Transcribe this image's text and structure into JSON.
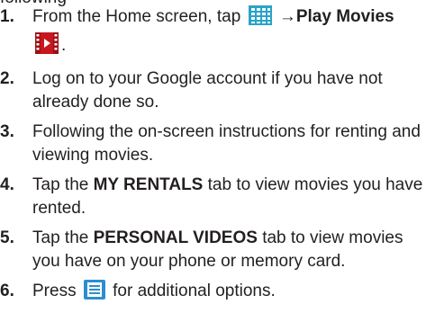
{
  "fragment_top": "following",
  "steps": [
    {
      "number": "1.",
      "before": "From the Home screen, tap",
      "apps_icon": "apps-grid-icon",
      "arrow": "→",
      "app_name": "Play Movies",
      "movies_icon": "play-movies-icon",
      "after": "."
    },
    {
      "number": "2.",
      "text": "Log on to your Google account if you have not already done so."
    },
    {
      "number": "3.",
      "text": "Following the on-screen instructions for renting and viewing movies."
    },
    {
      "number": "4.",
      "before": "Tap the",
      "bold": "MY RENTALS",
      "after": "tab to view movies you have rented."
    },
    {
      "number": "5.",
      "before": "Tap the",
      "bold": "PERSONAL VIDEOS",
      "after": "tab to view movies you have on your phone or memory card."
    },
    {
      "number": "6.",
      "before": "Press",
      "menu_icon": "menu-key-icon",
      "after": "for additional options."
    }
  ],
  "colors": {
    "text": "#231f20",
    "apps_icon": "#2aa3c9",
    "movies_icon": "#c8161e",
    "menu_icon": "#2b8ed0"
  }
}
